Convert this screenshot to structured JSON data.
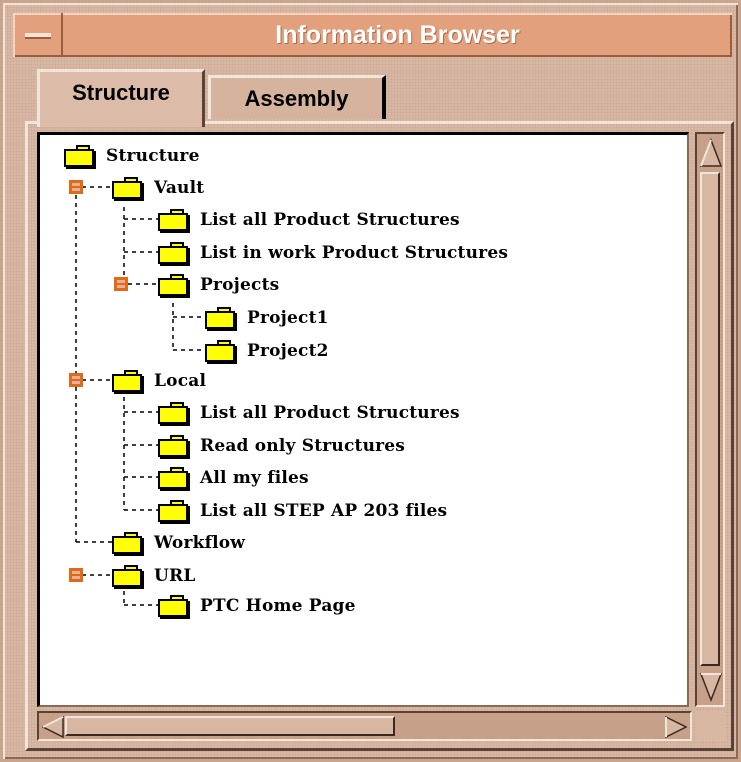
{
  "window": {
    "title": "Information Browser"
  },
  "tabs": [
    {
      "label": "Structure",
      "selected": true
    },
    {
      "label": "Assembly",
      "selected": false
    }
  ],
  "tree": {
    "root": "Structure",
    "nodes": [
      {
        "label": "Vault",
        "level": 1,
        "expanded": true,
        "icon": "folder-icon"
      },
      {
        "label": "List all Product Structures",
        "level": 2,
        "icon": "folder-icon"
      },
      {
        "label": "List in work Product Structures",
        "level": 2,
        "icon": "folder-icon"
      },
      {
        "label": "Projects",
        "level": 2,
        "expanded": true,
        "icon": "folder-icon"
      },
      {
        "label": "Project1",
        "level": 3,
        "icon": "folder-icon"
      },
      {
        "label": "Project2",
        "level": 3,
        "icon": "folder-icon"
      },
      {
        "label": "Local",
        "level": 1,
        "expanded": true,
        "icon": "folder-icon"
      },
      {
        "label": "List all Product Structures",
        "level": 2,
        "icon": "folder-icon"
      },
      {
        "label": "Read only Structures",
        "level": 2,
        "icon": "folder-icon"
      },
      {
        "label": "All my files",
        "level": 2,
        "icon": "folder-icon"
      },
      {
        "label": "List all STEP AP 203 files",
        "level": 2,
        "icon": "folder-icon"
      },
      {
        "label": "Workflow",
        "level": 1,
        "icon": "folder-icon"
      },
      {
        "label": "URL",
        "level": 1,
        "expanded": true,
        "icon": "folder-icon"
      },
      {
        "label": "PTC Home Page",
        "level": 2,
        "icon": "folder-icon"
      }
    ]
  },
  "colors": {
    "window_bg": "#d9b8a3",
    "titlebar": "#e3a07c",
    "folder": "#ffff00",
    "expander": "#e06a16",
    "tree_bg": "#ffffff"
  }
}
